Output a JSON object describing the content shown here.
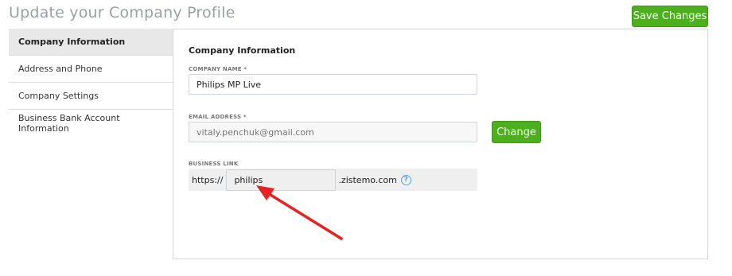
{
  "page": {
    "title": "Update your Company Profile"
  },
  "toolbar": {
    "save_label": "Save Changes"
  },
  "sidebar": {
    "items": [
      {
        "label": "Company Information",
        "active": true
      },
      {
        "label": "Address and Phone",
        "active": false
      },
      {
        "label": "Company Settings",
        "active": false
      },
      {
        "label": "Business Bank Account Information",
        "active": false
      }
    ]
  },
  "form": {
    "section_title": "Company Information",
    "company_name": {
      "label": "COMPANY NAME *",
      "value": "Philips MP Live"
    },
    "email": {
      "label": "EMAIL ADDRESS *",
      "placeholder": "vitaly.penchuk@gmail.com",
      "change_label": "Change"
    },
    "business_link": {
      "label": "BUSINESS LINK",
      "prefix": "https://",
      "value": "philips",
      "suffix": ".zistemo.com",
      "help": "?"
    }
  },
  "colors": {
    "accent": "#4caf1e",
    "annotation": "#e8201f",
    "help": "#58a6c9"
  },
  "icons": {
    "help": "question-circle-icon",
    "annotation": "red-arrow-annotation"
  }
}
